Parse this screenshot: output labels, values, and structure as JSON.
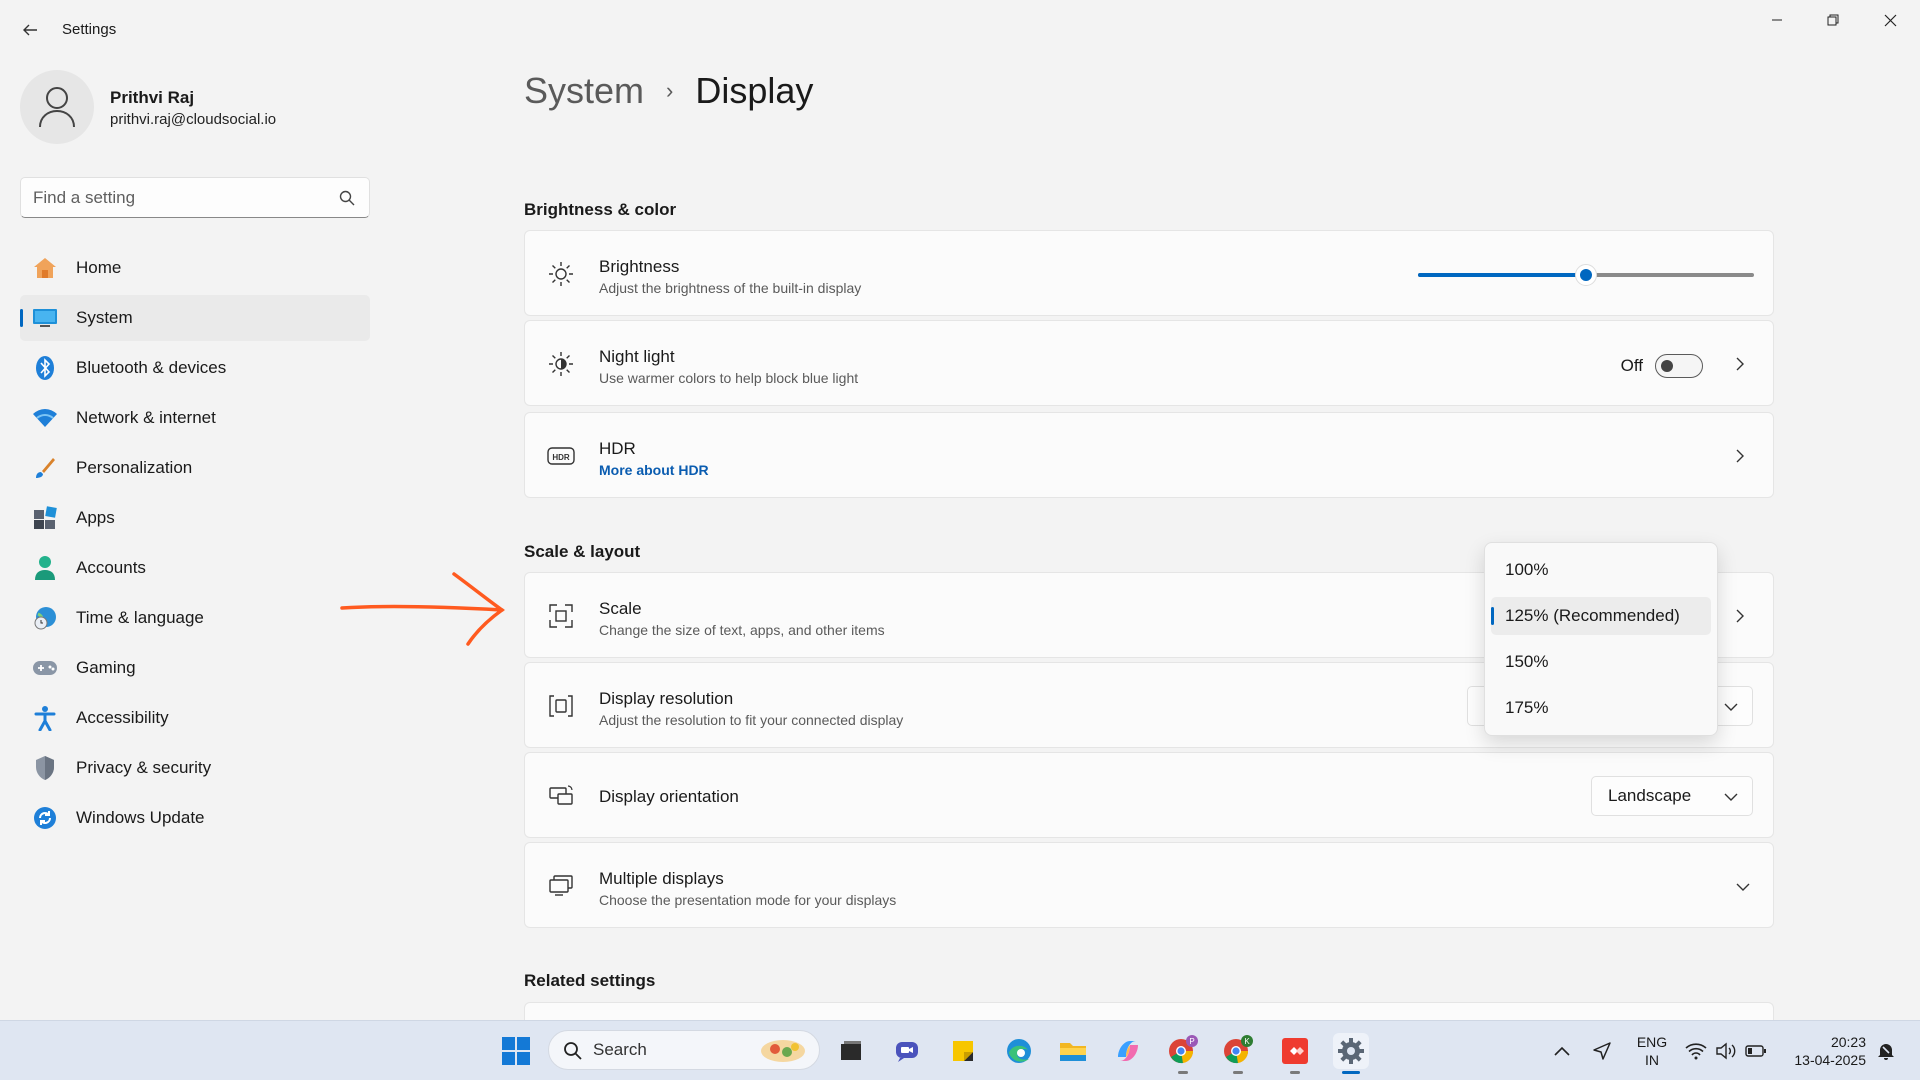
{
  "window": {
    "title": "Settings",
    "controls": [
      "minimize",
      "restore",
      "close"
    ]
  },
  "profile": {
    "name": "Prithvi Raj",
    "email": "prithvi.raj@cloudsocial.io"
  },
  "search": {
    "placeholder": "Find a setting",
    "value": ""
  },
  "sidebar": {
    "items": [
      {
        "label": "Home",
        "icon": "home-icon"
      },
      {
        "label": "System",
        "icon": "system-icon",
        "active": true
      },
      {
        "label": "Bluetooth & devices",
        "icon": "bluetooth-icon"
      },
      {
        "label": "Network & internet",
        "icon": "wifi-icon"
      },
      {
        "label": "Personalization",
        "icon": "brush-icon"
      },
      {
        "label": "Apps",
        "icon": "apps-icon"
      },
      {
        "label": "Accounts",
        "icon": "accounts-icon"
      },
      {
        "label": "Time & language",
        "icon": "globe-clock-icon"
      },
      {
        "label": "Gaming",
        "icon": "gamepad-icon"
      },
      {
        "label": "Accessibility",
        "icon": "accessibility-icon"
      },
      {
        "label": "Privacy & security",
        "icon": "shield-icon"
      },
      {
        "label": "Windows Update",
        "icon": "update-icon"
      }
    ]
  },
  "breadcrumb": {
    "parent": "System",
    "separator": "›",
    "current": "Display"
  },
  "sections": {
    "brightness_color": "Brightness & color",
    "scale_layout": "Scale & layout",
    "related": "Related settings"
  },
  "brightness": {
    "title": "Brightness",
    "subtitle": "Adjust the brightness of the built-in display",
    "level": 0.5
  },
  "night_light": {
    "title": "Night light",
    "subtitle": "Use warmer colors to help block blue light",
    "state": "Off"
  },
  "hdr": {
    "title": "HDR",
    "link": "More about HDR"
  },
  "scale": {
    "title": "Scale",
    "subtitle": "Change the size of text, apps, and other items",
    "options": [
      "100%",
      "125% (Recommended)",
      "150%",
      "175%"
    ],
    "selected": "125% (Recommended)"
  },
  "resolution": {
    "title": "Display resolution",
    "subtitle": "Adjust the resolution to fit your connected display"
  },
  "orientation": {
    "title": "Display orientation",
    "value": "Landscape"
  },
  "multiple_displays": {
    "title": "Multiple displays",
    "subtitle": "Choose the presentation mode for your displays"
  },
  "taskbar": {
    "search_label": "Search",
    "apps": [
      "task-view-icon",
      "teams-icon",
      "sticky-notes-icon",
      "edge-icon",
      "file-explorer-icon",
      "copilot-icon",
      "chrome-icon",
      "chrome-icon",
      "anydesk-icon",
      "settings-icon"
    ],
    "lang_line1": "ENG",
    "lang_line2": "IN",
    "time": "20:23",
    "date": "13-04-2025"
  },
  "colors": {
    "accent": "#0067c0",
    "annotation": "#ff5a1f",
    "link": "#0a5cb0"
  }
}
